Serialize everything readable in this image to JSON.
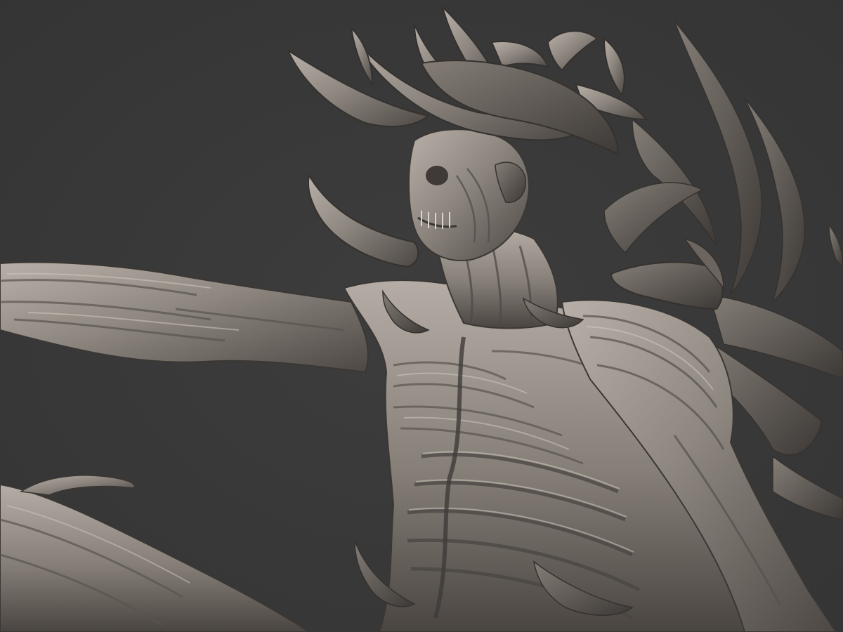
{
  "scene": {
    "background_color": "#3a3a3a",
    "material_color": "#8d8781",
    "material_highlight": "#c9c2ba",
    "material_shadow": "#3e3a37",
    "subject": "sculpt-render-creature"
  }
}
